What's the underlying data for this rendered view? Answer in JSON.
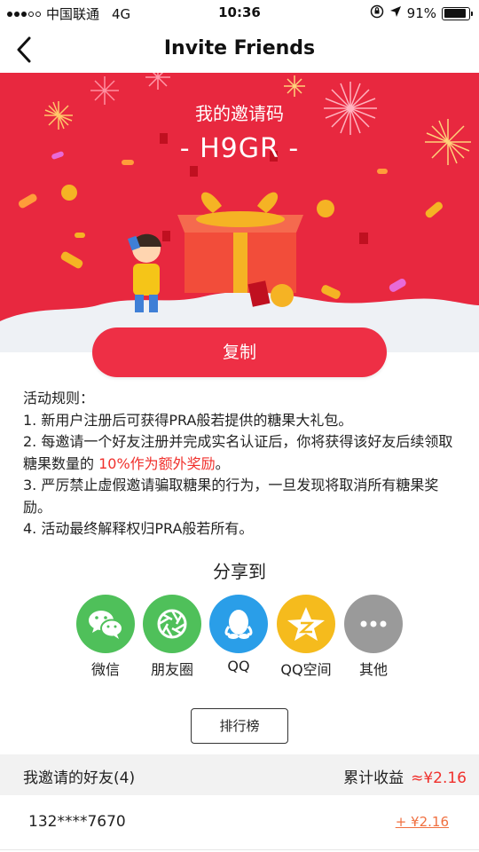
{
  "status_bar": {
    "carrier": "中国联通",
    "network": "4G",
    "time": "10:36",
    "battery": "91%",
    "battery_level": 0.91
  },
  "navbar": {
    "title": "Invite Friends",
    "back_icon": "chevron-left-icon"
  },
  "banner": {
    "code_title": "我的邀请码",
    "code": "- H9GR -",
    "background_color": "#e8283f"
  },
  "copy_button": {
    "label": "复制"
  },
  "rules": {
    "heading": "活动规则：",
    "item1": "1. 新用户注册后可获得PRA般若提供的糖果大礼包。",
    "item2_prefix": "2. 每邀请一个好友注册并完成实名认证后，你将获得该好友后续领取糖果数量的 ",
    "item2_highlight": "10%作为额外奖励",
    "item2_suffix": "。",
    "item3": "3. 严厉禁止虚假邀请骗取糖果的行为，一旦发现将取消所有糖果奖励。",
    "item4": "4. 活动最终解释权归PRA般若所有。"
  },
  "share": {
    "title": "分享到",
    "items": [
      {
        "label": "微信",
        "icon": "wechat-icon",
        "color": "#4fc05a"
      },
      {
        "label": "朋友圈",
        "icon": "moments-icon",
        "color": "#4fc05a"
      },
      {
        "label": "QQ",
        "icon": "qq-icon",
        "color": "#2a9ee8"
      },
      {
        "label": "QQ空间",
        "icon": "qzone-icon",
        "color": "#f5bb1d"
      },
      {
        "label": "其他",
        "icon": "more-icon",
        "color": "#9a9a9a"
      }
    ]
  },
  "ranking_button": {
    "label": "排行榜"
  },
  "friends": {
    "header_label": "我邀请的好友(4)",
    "total_label": "累计收益",
    "total_amount": "≈¥2.16",
    "rows": [
      {
        "phone": "132****7670",
        "reward": "+ ¥2.16"
      }
    ]
  },
  "colors": {
    "accent": "#ee2f45",
    "highlight": "#f0302c",
    "reward": "#f07040"
  }
}
